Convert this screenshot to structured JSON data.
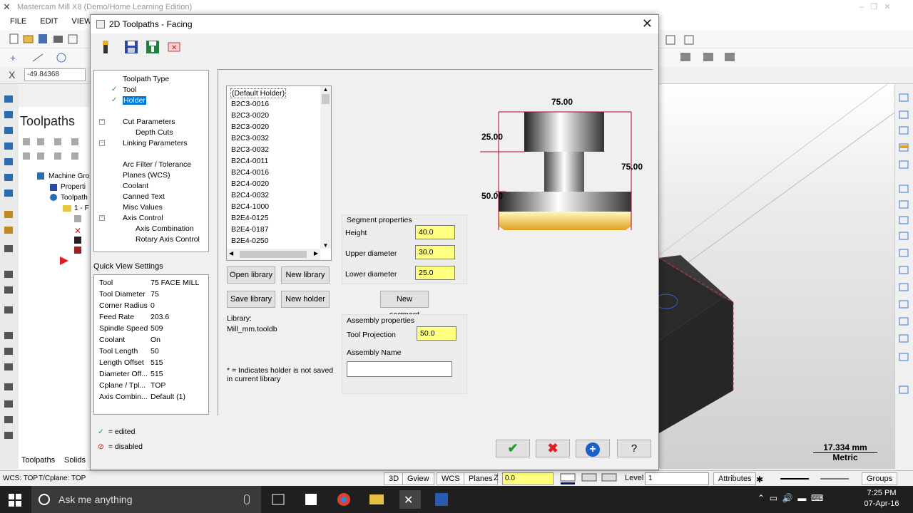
{
  "app": {
    "title": "Mastercam Mill X8 (Demo/Home Learning Edition)",
    "menu": [
      "FILE",
      "EDIT",
      "VIEW"
    ],
    "coord_label": "X",
    "coord_value": "-49.84368",
    "manager_title": "Toolpaths",
    "manager_items": [
      "Machine Gro",
      "Properti",
      "Toolpath",
      "1 - F"
    ],
    "bottom_tabs": [
      "Toolpaths",
      "Solids"
    ],
    "scale_value": "17.334 mm",
    "scale_unit": "Metric"
  },
  "status": {
    "wcs": "WCS: TOP",
    "tcplane": "T/Cplane: TOP",
    "buttons": [
      "3D",
      "Gview",
      "WCS",
      "Planes"
    ],
    "z_label": "Z",
    "z_value": "0.0",
    "level_label": "Level",
    "level_value": "1",
    "attributes": "Attributes",
    "groups": "Groups"
  },
  "taskbar": {
    "search": "Ask me anything",
    "time": "7:25 PM",
    "date": "07-Apr-16"
  },
  "dialog": {
    "title": "2D Toolpaths - Facing",
    "tree": [
      {
        "label": "Toolpath Type",
        "check": false,
        "indent": 0
      },
      {
        "label": "Tool",
        "check": true,
        "indent": 0
      },
      {
        "label": "Holder",
        "check": true,
        "indent": 0,
        "selected": true
      },
      {
        "label": "Cut Parameters",
        "check": false,
        "indent": 0
      },
      {
        "label": "Depth Cuts",
        "check": false,
        "indent": 1
      },
      {
        "label": "Linking Parameters",
        "check": false,
        "indent": 0
      },
      {
        "label": "Arc Filter / Tolerance",
        "check": false,
        "indent": 0
      },
      {
        "label": "Planes (WCS)",
        "check": false,
        "indent": 0
      },
      {
        "label": "Coolant",
        "check": false,
        "indent": 0
      },
      {
        "label": "Canned Text",
        "check": false,
        "indent": 0
      },
      {
        "label": "Misc Values",
        "check": false,
        "indent": 0
      },
      {
        "label": "Axis Control",
        "check": false,
        "indent": 0
      },
      {
        "label": "Axis Combination",
        "check": false,
        "indent": 1
      },
      {
        "label": "Rotary Axis Control",
        "check": false,
        "indent": 1
      }
    ],
    "quick_view_label": "Quick View Settings",
    "quick_view": [
      {
        "k": "Tool",
        "v": "75 FACE MILL"
      },
      {
        "k": "Tool Diameter",
        "v": "75"
      },
      {
        "k": "Corner Radius",
        "v": "0"
      },
      {
        "k": "Feed Rate",
        "v": "203.6"
      },
      {
        "k": "Spindle Speed",
        "v": "509"
      },
      {
        "k": "Coolant",
        "v": "On"
      },
      {
        "k": "Tool Length",
        "v": "50"
      },
      {
        "k": "Length Offset",
        "v": "515"
      },
      {
        "k": "Diameter Off...",
        "v": "515"
      },
      {
        "k": "Cplane / Tpl...",
        "v": "TOP"
      },
      {
        "k": "Axis Combin...",
        "v": "Default (1)"
      }
    ],
    "legend_edited": "= edited",
    "legend_disabled": "= disabled",
    "holders": [
      "(Default Holder)",
      "B2C3-0016",
      "B2C3-0020",
      "B2C3-0020",
      "B2C3-0032",
      "B2C3-0032",
      "B2C4-0011",
      "B2C4-0016",
      "B2C4-0020",
      "B2C4-0032",
      "B2C4-1000",
      "B2E4-0125",
      "B2E4-0187",
      "B2E4-0250"
    ],
    "buttons": {
      "open_library": "Open library",
      "new_library": "New library",
      "save_library": "Save library",
      "new_holder": "New holder",
      "new_segment": "New segment"
    },
    "library_label": "Library:",
    "library_value": "Mill_mm.tooldb",
    "note": "* = Indicates holder is not saved in current library",
    "segment_properties": "Segment properties",
    "height_label": "Height",
    "height_value": "40.0",
    "upper_label": "Upper diameter",
    "upper_value": "30.0",
    "lower_label": "Lower diameter",
    "lower_value": "25.0",
    "assembly_properties": "Assembly properties",
    "projection_label": "Tool Projection",
    "projection_value": "50.0",
    "assembly_name_label": "Assembly Name",
    "assembly_name_value": "",
    "preview": {
      "top_dim": "75.00",
      "left_dim": "25.00",
      "right_dim": "75.00",
      "lower_dim": "50.00"
    }
  }
}
